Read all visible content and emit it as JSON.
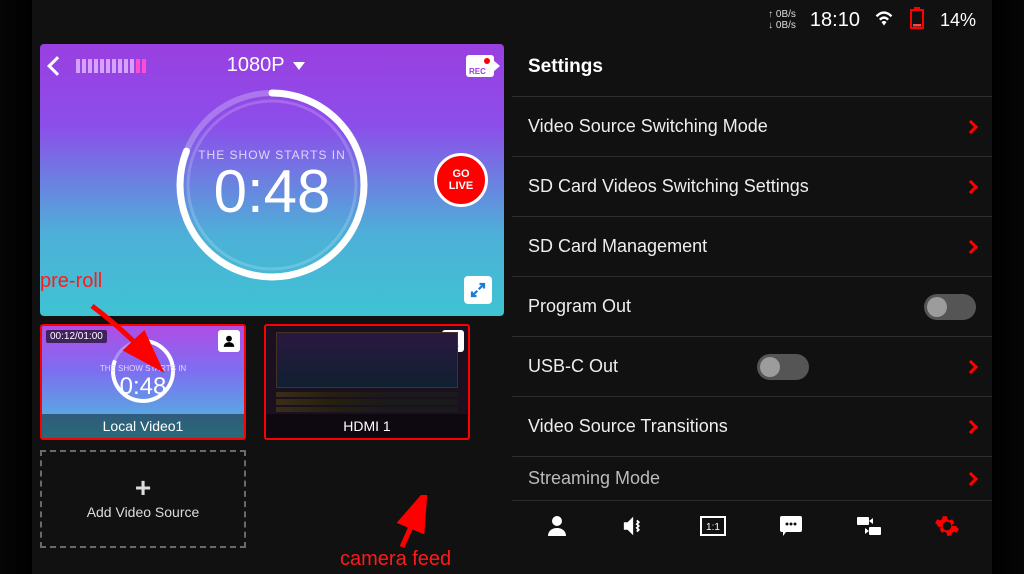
{
  "status": {
    "up_rate": "↑ 0B/s",
    "down_rate": "↓ 0B/s",
    "clock": "18:10",
    "battery": "14%"
  },
  "preview": {
    "resolution": "1080P",
    "countdown_label": "THE SHOW STARTS IN",
    "countdown_time": "0:48",
    "go_live_line1": "GO",
    "go_live_line2": "LIVE",
    "rec_label": "REC"
  },
  "annotations": {
    "preroll": "pre-roll",
    "camera_feed": "camera feed"
  },
  "sources": {
    "thumb1_timecode": "00:12/01:00",
    "thumb1_mini_label": "THE SHOW STARTS IN",
    "thumb1_mini_time": "0:48",
    "thumb1_name": "Local Video1",
    "thumb2_name": "HDMI 1",
    "add_label": "Add Video Source"
  },
  "settings": {
    "title": "Settings",
    "items": [
      {
        "label": "Video Source Switching Mode",
        "type": "link"
      },
      {
        "label": "SD Card Videos Switching Settings",
        "type": "link"
      },
      {
        "label": "SD Card Management",
        "type": "link"
      },
      {
        "label": "Program Out",
        "type": "toggle"
      },
      {
        "label": "USB-C Out",
        "type": "toggle_link"
      },
      {
        "label": "Video Source Transitions",
        "type": "link"
      },
      {
        "label": "Streaming Mode",
        "type": "link"
      }
    ]
  }
}
